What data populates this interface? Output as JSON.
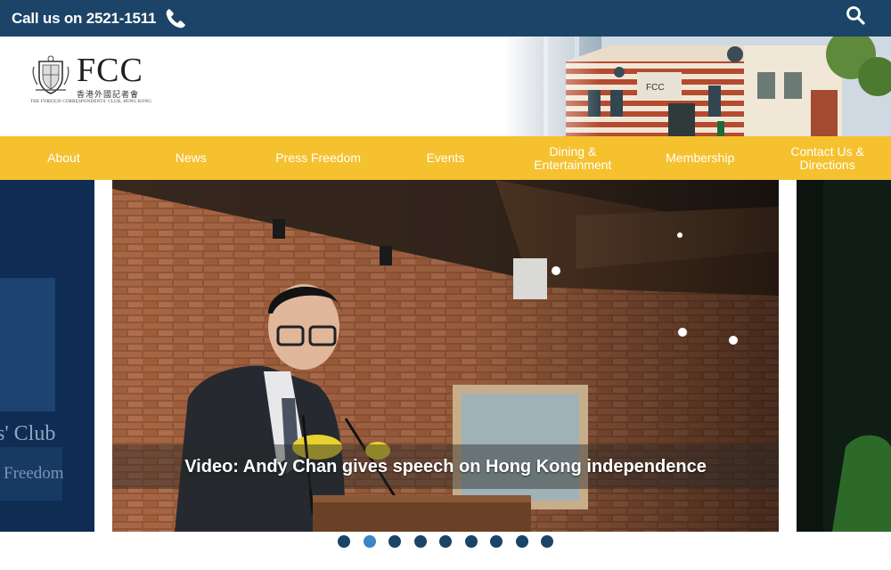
{
  "topbar": {
    "call_text": "Call us on 2521-1511",
    "phone_icon": "phone-icon",
    "search_icon": "search-icon",
    "background": "#1b4468"
  },
  "logo": {
    "name": "FCC",
    "chinese": "香港外國記者會",
    "subtitle": "THE FOREIGN CORRESPONDENTS' CLUB, HONG KONG"
  },
  "nav": {
    "background": "#f5c12f",
    "items": [
      {
        "label": "About"
      },
      {
        "label": "News"
      },
      {
        "label": "Press Freedom"
      },
      {
        "label": "Events"
      },
      {
        "label": "Dining & Entertainment"
      },
      {
        "label": "Membership"
      },
      {
        "label": "Contact Us & Directions"
      }
    ]
  },
  "carousel": {
    "caption": "Video: Andy Chan gives speech on Hong Kong independence",
    "left_preview_text": [
      "s' Club",
      "Freedom"
    ],
    "dot_count": 9,
    "active_dot": 2
  }
}
